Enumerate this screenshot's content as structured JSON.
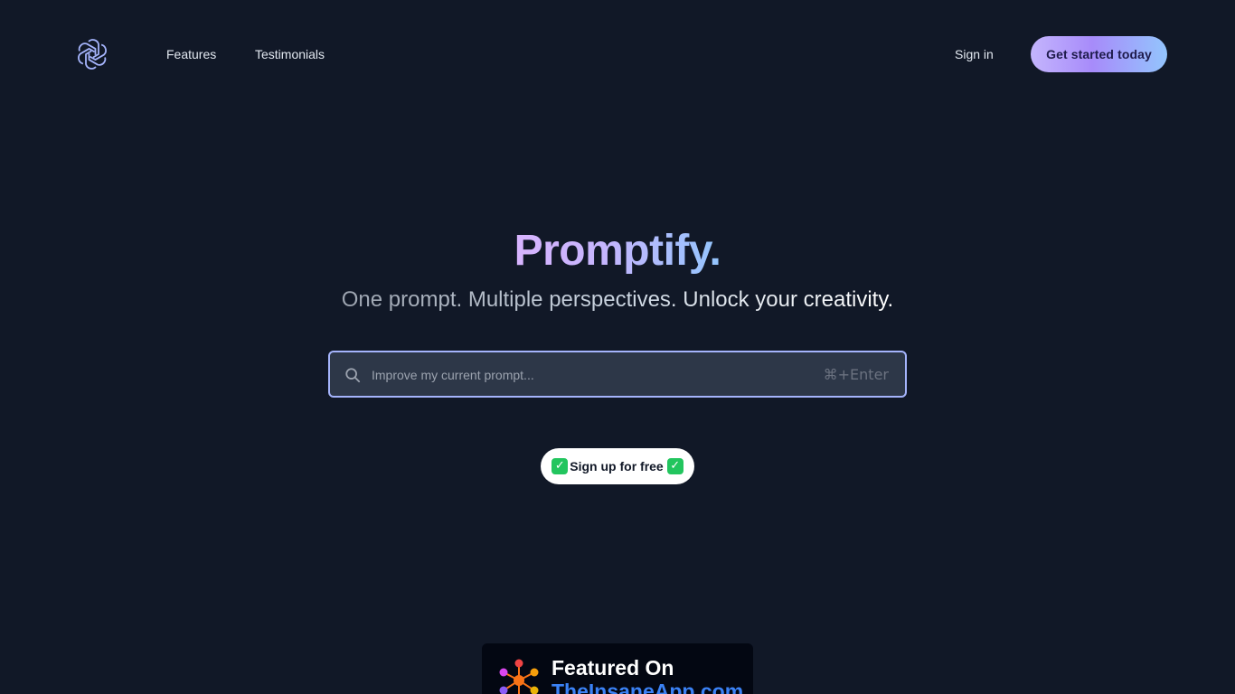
{
  "nav": {
    "logo_icon": "openai-knot-icon",
    "links": [
      {
        "label": "Features"
      },
      {
        "label": "Testimonials"
      }
    ],
    "sign_in_label": "Sign in",
    "cta_label": "Get started today"
  },
  "hero": {
    "title": "Promptify.",
    "subtitle": "One prompt. Multiple perspectives. Unlock your creativity."
  },
  "search": {
    "placeholder": "Improve my current prompt...",
    "value": "",
    "shortcut": "⌘+Enter",
    "icon": "search-icon"
  },
  "signup": {
    "label": "Sign up for free",
    "icon": "check-mark-icon"
  },
  "featured": {
    "line1": "Featured On",
    "line2": "TheInsaneApp.com",
    "icon": "network-nodes-icon"
  },
  "colors": {
    "background": "#111827",
    "accent_purple": "#c4b5fd",
    "accent_blue": "#93c5fd",
    "search_border": "#a5b4fc",
    "check_green": "#22c55e"
  }
}
